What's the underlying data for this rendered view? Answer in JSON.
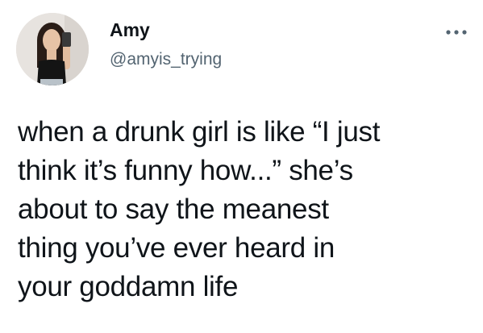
{
  "author": {
    "name": "Amy",
    "handle": "@amyis_trying"
  },
  "tweet": {
    "lines": [
      "when a drunk girl is like “I just",
      "think it’s funny how...” she’s",
      "about to say the meanest",
      "thing you’ve ever heard in",
      "your goddamn life"
    ]
  },
  "icons": {
    "more": "more-horizontal-icon",
    "avatar": "profile-photo"
  },
  "colors": {
    "text": "#0f1419",
    "secondary": "#536471",
    "background": "#ffffff"
  }
}
